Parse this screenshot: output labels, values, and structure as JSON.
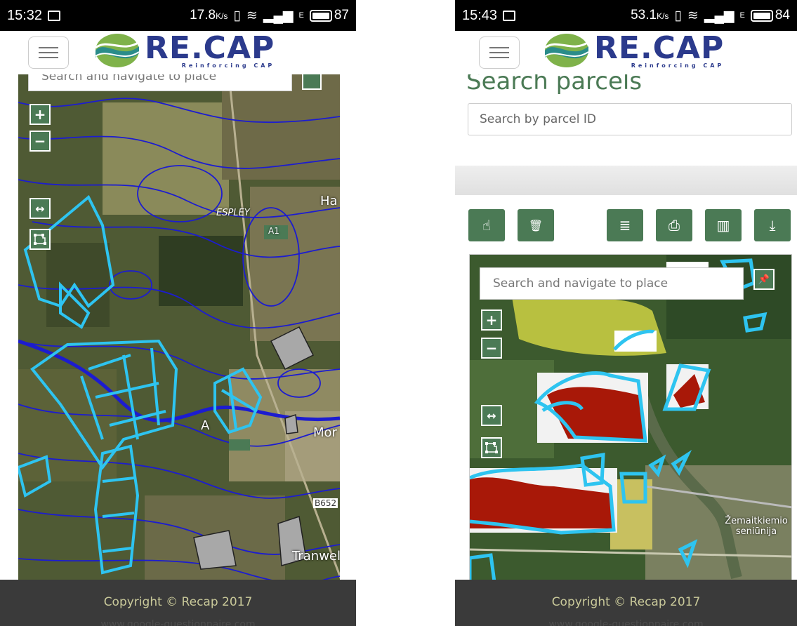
{
  "left_phone": {
    "status": {
      "time": "15:32",
      "speed": "17.8",
      "speed_unit": "K/s",
      "network": "E",
      "battery": "87"
    },
    "logo": {
      "title": "RE.CAP",
      "subtitle": "Reinforcing CAP"
    },
    "map": {
      "search_placeholder": "Search and navigate to place",
      "zoom_in": "+",
      "zoom_out": "−",
      "measure_icon": "↔",
      "labels": {
        "espley": "ESPLEY",
        "a1": "A1",
        "ha": "Ha",
        "mor": "Mor",
        "ar": "A",
        "b65": "B652",
        "tranwell": "Tranwell"
      }
    },
    "footer": {
      "copyright": "Copyright © Recap 2017",
      "watermark": "www.google-questionnaire.com"
    }
  },
  "right_phone": {
    "status": {
      "time": "15:43",
      "speed": "53.1",
      "speed_unit": "K/s",
      "network": "E",
      "battery": "84"
    },
    "logo": {
      "title": "RE.CAP",
      "subtitle": "Reinforcing CAP"
    },
    "section_title": "Search parcels",
    "parcel_search_placeholder": "Search by parcel ID",
    "toolbar": {
      "select_icon": "☝",
      "delete_icon": "🗑",
      "list_icon": "≣",
      "print_icon": "⎙",
      "map_icon": "▥",
      "download_icon": "⤓"
    },
    "map": {
      "search_placeholder": "Search and navigate to place",
      "pin_icon": "📌",
      "zoom_in": "+",
      "zoom_out": "−",
      "measure_icon": "↔",
      "place_label": "Žemaitkiemio seniūnija"
    },
    "footer": {
      "copyright": "Copyright © Recap 2017",
      "watermark": "www.google-questionnaire.com"
    }
  },
  "colors": {
    "brand_green": "#4b7a55",
    "brand_blue": "#2b3a8c",
    "parcel_cyan": "#2ec4f0",
    "contour_blue": "#1c1cd0",
    "footer_bg": "#3a3a3a"
  }
}
